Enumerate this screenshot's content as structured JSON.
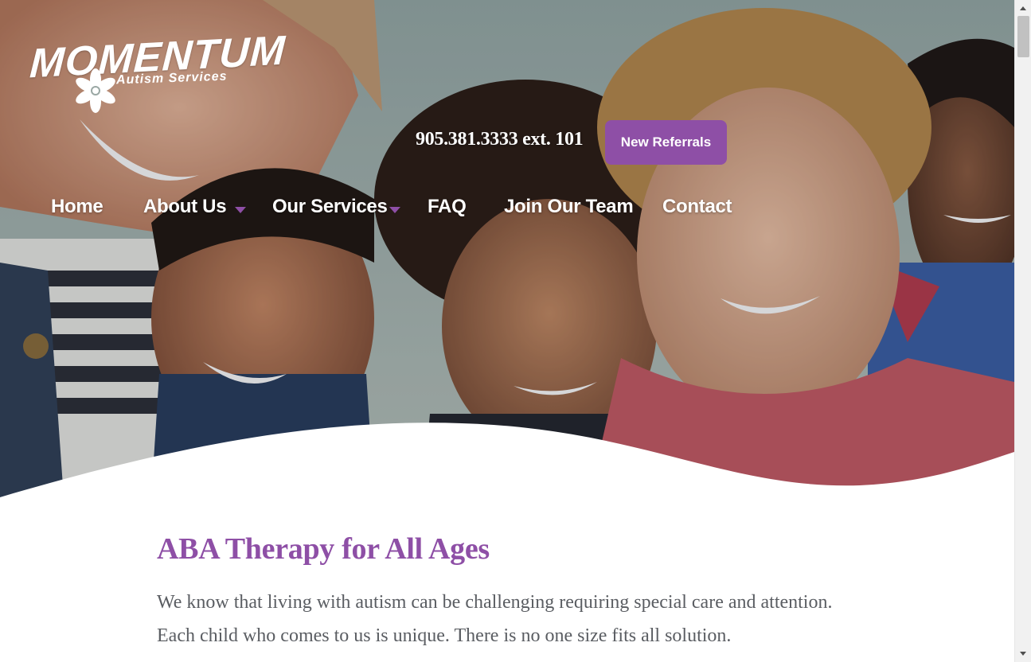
{
  "brand": {
    "name": "MOMENTUM",
    "tagline": "Autism Services"
  },
  "header": {
    "phone": "905.381.3333 ext. 101",
    "cta_label": "New Referrals"
  },
  "nav": {
    "items": [
      {
        "label": "Home",
        "has_dropdown": false
      },
      {
        "label": "About Us",
        "has_dropdown": true
      },
      {
        "label": "Our Services",
        "has_dropdown": true
      },
      {
        "label": "FAQ",
        "has_dropdown": false
      },
      {
        "label": "Join Our Team",
        "has_dropdown": false
      },
      {
        "label": "Contact",
        "has_dropdown": false
      }
    ]
  },
  "hero": {
    "image_icon": "children-smiling-photo"
  },
  "main": {
    "heading": "ABA Therapy for All Ages",
    "paragraph": "We know that living with autism can be challenging requiring special care and attention. Each child who comes to us is unique. There is no one size fits all solution."
  },
  "colors": {
    "accent": "#8e4fa6",
    "body_text": "#5a5d62",
    "white": "#ffffff"
  }
}
